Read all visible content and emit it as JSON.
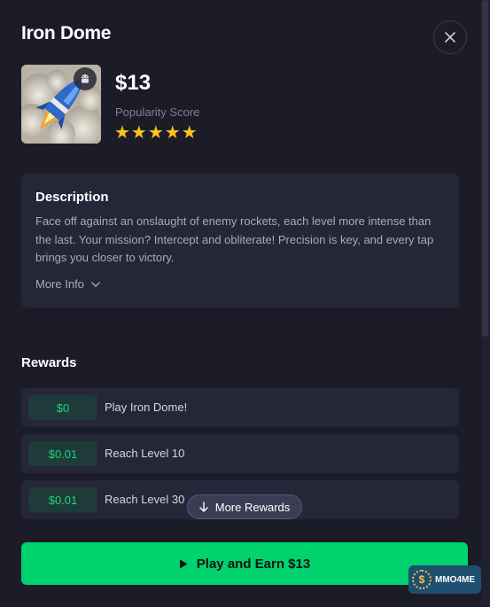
{
  "modal": {
    "title": "Iron Dome"
  },
  "app": {
    "price": "$13",
    "popularity_label": "Popularity Score",
    "stars": "★★★★★",
    "star_color": "#ffc21a",
    "rating": 5,
    "platform_icon": "android-icon"
  },
  "description": {
    "title": "Description",
    "text": "Face off against an onslaught of enemy rockets, each level more intense than the last. Your mission? Intercept and obliterate! Precision is key, and every tap brings you closer to victory.",
    "more_info_label": "More Info"
  },
  "rewards": {
    "title": "Rewards",
    "items": [
      {
        "amount": "$0",
        "label": "Play Iron Dome!"
      },
      {
        "amount": "$0.01",
        "label": "Reach Level 10"
      },
      {
        "amount": "$0.01",
        "label": "Reach Level 30"
      }
    ],
    "more_label": "More Rewards"
  },
  "cta": {
    "label": "Play and Earn $13",
    "color": "#00d26e"
  },
  "watermark": {
    "text": "MMO4ME"
  }
}
